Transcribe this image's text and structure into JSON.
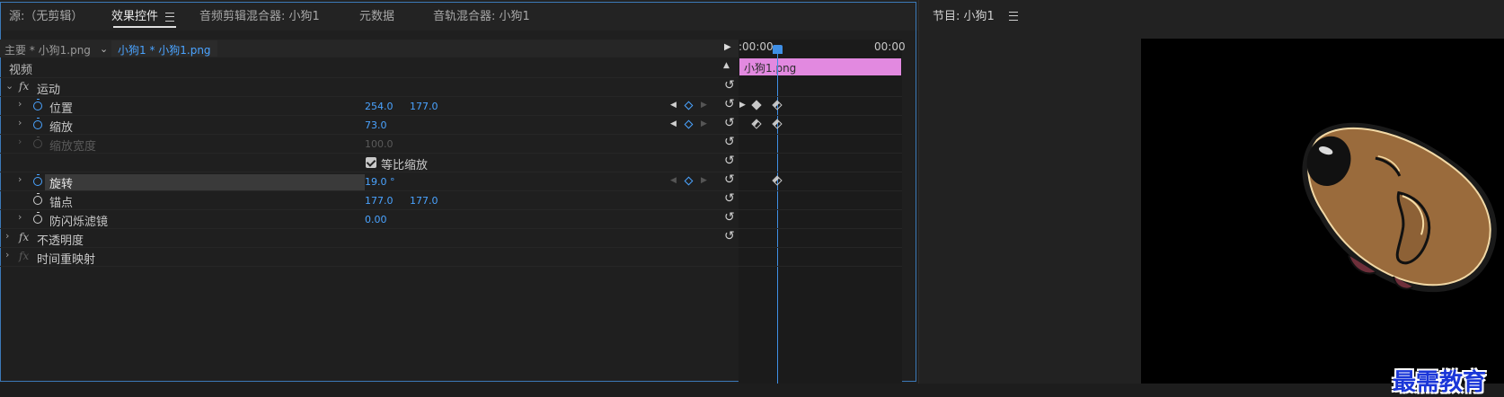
{
  "effects_panel": {
    "tabs": [
      {
        "label": "源:（无剪辑）"
      },
      {
        "label": "效果控件"
      },
      {
        "label": "音频剪辑混合器: 小狗1"
      },
      {
        "label": "元数据"
      },
      {
        "label": "音轨混合器: 小狗1"
      }
    ],
    "active_tab": "效果控件",
    "clip_master": "主要 * 小狗1.png",
    "clip_current": "小狗1 * 小狗1.png",
    "timeline": {
      "time_left": ":00:00",
      "time_right": "00:00",
      "clip_label": "小狗1.png",
      "clip_color": "#e289e0",
      "playhead_color": "#3f8fe6"
    },
    "section_video": "视频",
    "effects": {
      "motion": {
        "label": "运动"
      },
      "position": {
        "label": "位置",
        "x": "254.0",
        "y": "177.0"
      },
      "scale": {
        "label": "缩放",
        "value": "73.0"
      },
      "scale_width": {
        "label": "缩放宽度",
        "value": "100.0"
      },
      "uniform_scale": {
        "label": "等比缩放",
        "checked": true
      },
      "rotation": {
        "label": "旋转",
        "value": "19.0 °"
      },
      "anchor": {
        "label": "锚点",
        "x": "177.0",
        "y": "177.0"
      },
      "anti_flicker": {
        "label": "防闪烁滤镜",
        "value": "0.00"
      },
      "opacity": {
        "label": "不透明度"
      },
      "time_remap": {
        "label": "时间重映射"
      }
    },
    "fx_label": "fx",
    "accent_color": "#4aa3ff"
  },
  "program_panel": {
    "title": "节目: 小狗1"
  },
  "watermark": "最需教育"
}
